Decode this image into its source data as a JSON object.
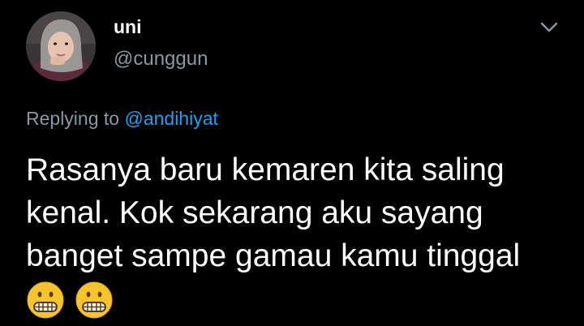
{
  "tweet": {
    "display_name": "uni",
    "handle": "@cunggun",
    "replying_prefix": "Replying to",
    "replying_mention": "@andihiyat",
    "body_lines": [
      "Rasanya baru kemaren kita saling",
      "kenal. Kok sekarang aku sayang",
      "banget sampe gamau kamu tinggal"
    ],
    "emojis": [
      "grimacing-face-icon",
      "grimacing-face-icon"
    ]
  },
  "icons": {
    "menu": "chevron-down-icon",
    "avatar": "profile-photo"
  },
  "colors": {
    "background": "#000000",
    "primary_text": "#ffffff",
    "secondary_text": "#8899a6",
    "link": "#1da1f2",
    "emoji_face": "#f7c52b"
  }
}
